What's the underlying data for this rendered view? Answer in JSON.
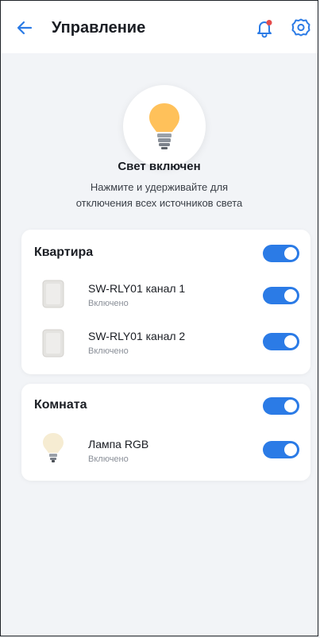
{
  "header": {
    "title": "Управление"
  },
  "hero": {
    "status": "Свет включен",
    "hint_line1": "Нажмите и удерживайте для",
    "hint_line2": "отключения всех источников света"
  },
  "groups": [
    {
      "name": "Квартира",
      "enabled": true,
      "devices": [
        {
          "name": "SW-RLY01 канал 1",
          "state": "Включено",
          "icon": "wall-switch-icon",
          "enabled": true
        },
        {
          "name": "SW-RLY01 канал 2",
          "state": "Включено",
          "icon": "wall-switch-icon",
          "enabled": true
        }
      ]
    },
    {
      "name": "Комната",
      "enabled": true,
      "devices": [
        {
          "name": "Лампа RGB",
          "state": "Включено",
          "icon": "bulb-icon",
          "enabled": true
        }
      ]
    }
  ],
  "colors": {
    "accent": "#2b7be6",
    "background": "#f2f4f7",
    "bulb": "#ffc15a",
    "notification_dot": "#e54b4b"
  }
}
